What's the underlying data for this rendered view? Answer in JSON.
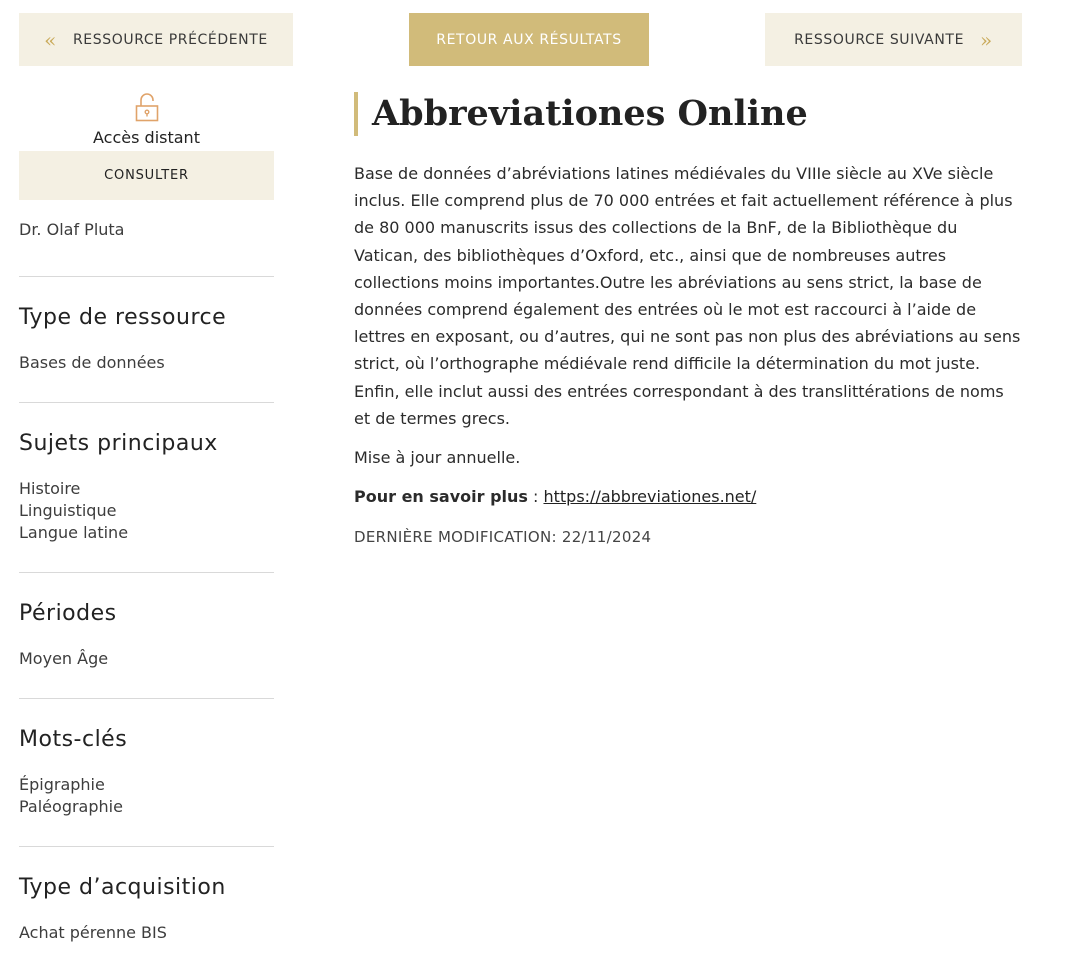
{
  "nav": {
    "prev_label": "Ressource précédente",
    "back_label": "Retour aux résultats",
    "next_label": "Ressource suivante",
    "prev_glyph": "«",
    "next_glyph": "»"
  },
  "sidebar": {
    "access_icon": "unlock-icon",
    "access_label": "Accès distant",
    "consult_label": "Consulter",
    "author": "Dr. Olaf Pluta",
    "sections": [
      {
        "title": "Type de ressource",
        "items": [
          "Bases de données"
        ]
      },
      {
        "title": "Sujets principaux",
        "items": [
          "Histoire",
          "Linguistique",
          "Langue latine"
        ]
      },
      {
        "title": "Périodes",
        "items": [
          "Moyen Âge"
        ]
      },
      {
        "title": "Mots-clés",
        "items": [
          "Épigraphie",
          "Paléographie"
        ]
      },
      {
        "title": "Type d’acquisition",
        "items": [
          "Achat pérenne BIS"
        ]
      }
    ]
  },
  "main": {
    "title": "Abbreviationes Online",
    "description": "Base de données d’abréviations latines médiévales du VIIIe siècle au XVe siècle inclus. Elle comprend plus de 70 000 entrées et fait actuellement référence à plus de 80 000 manuscrits issus des collections de la BnF, de la Bibliothèque du Vatican, des bibliothèques d’Oxford, etc., ainsi que de nombreuses autres collections moins importantes.Outre les abréviations au sens strict, la base de données comprend également des entrées où le mot est raccourci à l’aide de lettres en exposant, ou d’autres, qui ne sont pas non plus des abréviations au sens strict, où l’orthographe médiévale rend difficile la détermination du mot juste. Enfin, elle inclut aussi des entrées correspondant à des translittérations de noms et de termes grecs.",
    "update": "Mise à jour annuelle.",
    "more_label": "Pour en savoir plus",
    "more_sep": " : ",
    "more_link": "https://abbreviationes.net/",
    "modified": "Dernière modification: 22/11/2024"
  },
  "colors": {
    "accent": "#d1bb7a",
    "light_bg": "#f4f0e3",
    "chevron": "#c9aa5a"
  }
}
